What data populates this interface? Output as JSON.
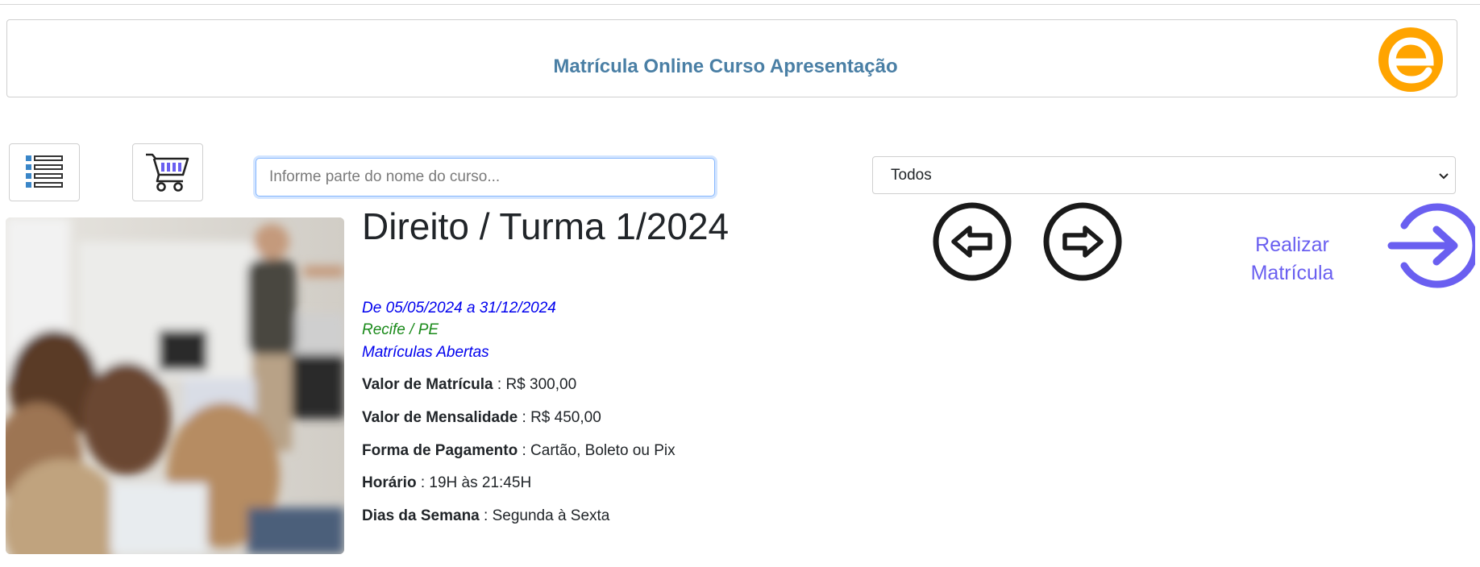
{
  "header": {
    "title": "Matrícula Online Curso Apresentação",
    "logo_letter": "e",
    "logo_color": "#ffa400"
  },
  "toolbar": {
    "list_icon": "list-icon",
    "cart_icon": "shopping-cart-icon"
  },
  "search": {
    "placeholder": "Informe parte do nome do curso...",
    "value": ""
  },
  "filter": {
    "selected": "Todos"
  },
  "course": {
    "title": "Direito / Turma 1/2024",
    "dates": "De 05/05/2024 a 31/12/2024",
    "location": "Recife / PE",
    "status": "Matrículas Abertas",
    "details": [
      {
        "label": "Valor de Matrícula",
        "value": " : R$ 300,00"
      },
      {
        "label": "Valor de Mensalidade",
        "value": " : R$ 450,00"
      },
      {
        "label": "Forma de Pagamento",
        "value": " : Cartão, Boleto ou Pix"
      },
      {
        "label": "Horário",
        "value": " : 19H às 21:45H"
      },
      {
        "label": "Dias da Semana",
        "value": " : Segunda à Sexta"
      }
    ]
  },
  "navigation": {
    "prev_icon": "arrow-left-circle-icon",
    "next_icon": "arrow-right-circle-icon"
  },
  "enroll": {
    "line1": "Realizar",
    "line2": "Matrícula",
    "icon": "arrow-right-circle-icon"
  },
  "colors": {
    "title_blue": "#4a7fa5",
    "date_blue": "#0000ee",
    "location_green": "#1a8a1a",
    "status_blue": "#0000ee",
    "accent_purple": "#6a5ff0",
    "cart_accent": "#6a5ff0",
    "list_blue": "#3a86c8"
  }
}
